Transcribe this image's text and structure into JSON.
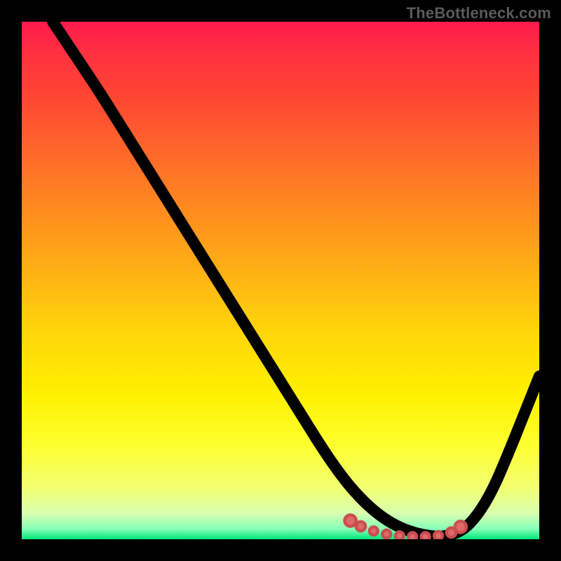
{
  "watermark": "TheBottleneck.com",
  "colors": {
    "curve": "#000000",
    "dot_fill": "#e06a6a",
    "dot_stroke": "#c94f4f",
    "frame_bg": "#000000"
  },
  "chart_data": {
    "type": "line",
    "title": "",
    "xlabel": "",
    "ylabel": "",
    "xlim": [
      0,
      100
    ],
    "ylim": [
      0,
      100
    ],
    "grid": false,
    "legend": false,
    "series": [
      {
        "name": "curve",
        "x": [
          6,
          10,
          15,
          20,
          25,
          30,
          35,
          40,
          45,
          50,
          55,
          58,
          61,
          64,
          67,
          70,
          73,
          76,
          79,
          81.5,
          85,
          88,
          91,
          94,
          97,
          100
        ],
        "y": [
          100,
          94,
          86.5,
          78.5,
          70.5,
          62.5,
          54.5,
          46.5,
          38.5,
          30.5,
          22.5,
          17.7,
          13.3,
          9.5,
          6.4,
          4.0,
          2.3,
          1.2,
          0.6,
          0.5,
          1.5,
          4.5,
          9.5,
          16.5,
          24.0,
          31.5
        ]
      }
    ],
    "markers": [
      {
        "x": 63.5,
        "y": 3.6,
        "r": 1.1
      },
      {
        "x": 65.5,
        "y": 2.5,
        "r": 0.9
      },
      {
        "x": 68.0,
        "y": 1.6,
        "r": 0.8
      },
      {
        "x": 70.5,
        "y": 1.0,
        "r": 0.8
      },
      {
        "x": 73.0,
        "y": 0.65,
        "r": 0.8
      },
      {
        "x": 75.5,
        "y": 0.5,
        "r": 0.8
      },
      {
        "x": 78.0,
        "y": 0.5,
        "r": 0.8
      },
      {
        "x": 80.5,
        "y": 0.7,
        "r": 0.8
      },
      {
        "x": 83.0,
        "y": 1.3,
        "r": 0.9
      },
      {
        "x": 84.8,
        "y": 2.4,
        "r": 1.1
      }
    ]
  }
}
